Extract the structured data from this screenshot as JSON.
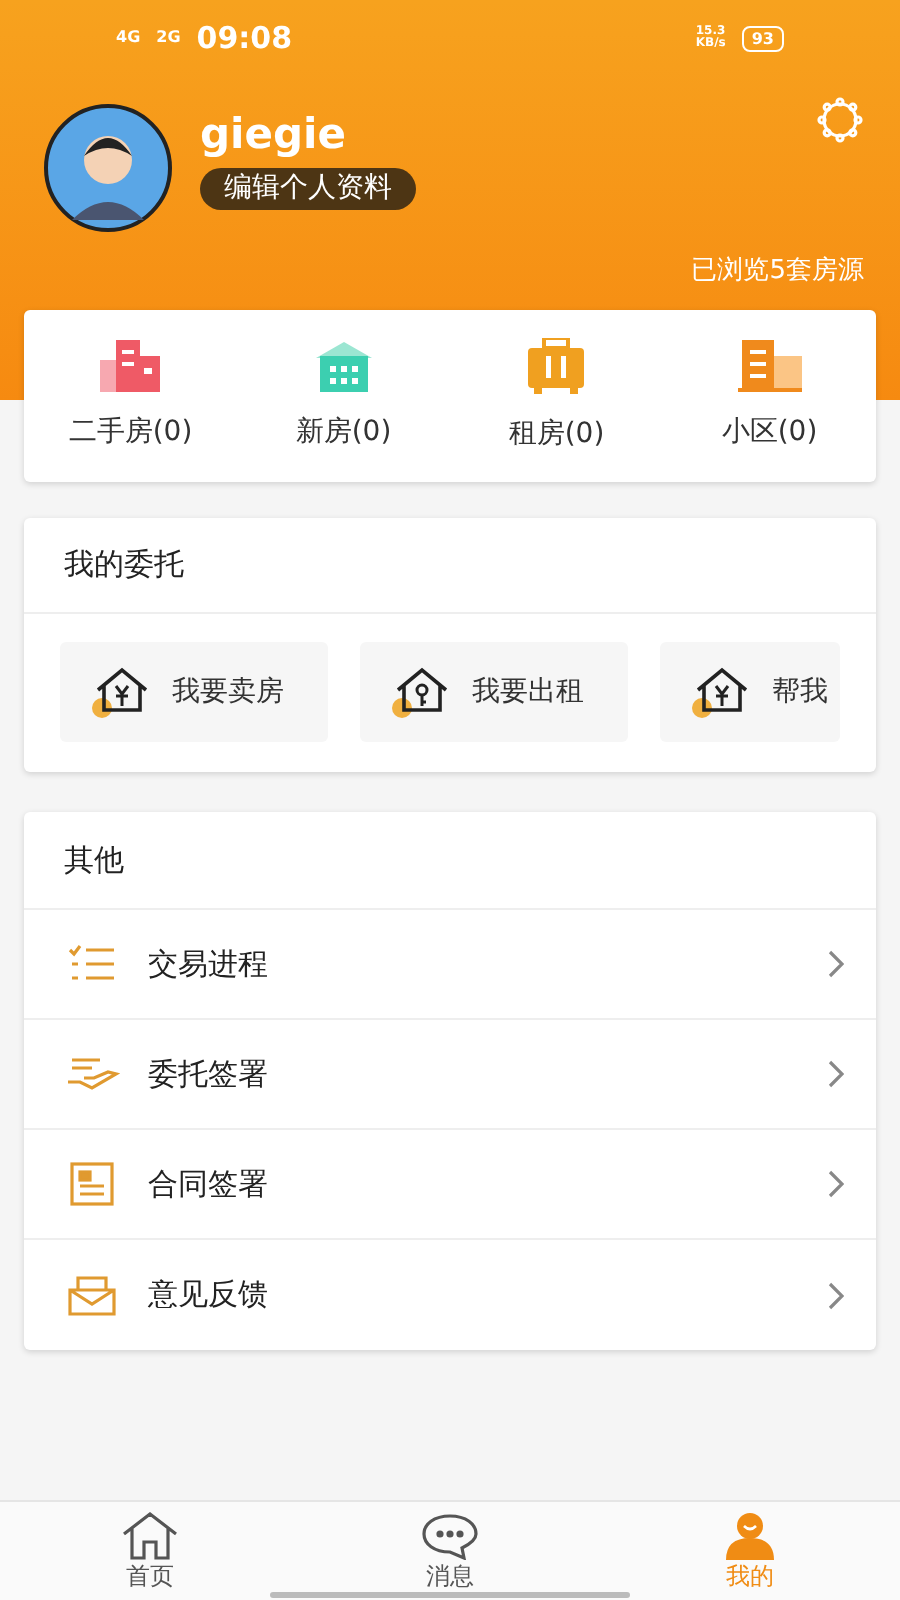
{
  "status_bar": {
    "network_1": "4G",
    "network_2": "2G",
    "time": "09:08",
    "speed_value": "15.3",
    "speed_unit": "KB/s",
    "battery": "93"
  },
  "profile": {
    "username": "giegie",
    "edit_button": "编辑个人资料",
    "browsed": "已浏览5套房源"
  },
  "stats": [
    {
      "label": "二手房(0)"
    },
    {
      "label": "新房(0)"
    },
    {
      "label": "租房(0)"
    },
    {
      "label": "小区(0)"
    }
  ],
  "entrust": {
    "title": "我的委托",
    "cards": [
      {
        "label": "我要卖房"
      },
      {
        "label": "我要出租"
      },
      {
        "label": "帮我"
      }
    ]
  },
  "other": {
    "title": "其他",
    "items": [
      {
        "label": "交易进程"
      },
      {
        "label": "委托签署"
      },
      {
        "label": "合同签署"
      },
      {
        "label": "意见反馈"
      }
    ]
  },
  "tab_bar": [
    {
      "label": "首页",
      "selected": false
    },
    {
      "label": "消息",
      "selected": false
    },
    {
      "label": "我的",
      "selected": true
    }
  ]
}
